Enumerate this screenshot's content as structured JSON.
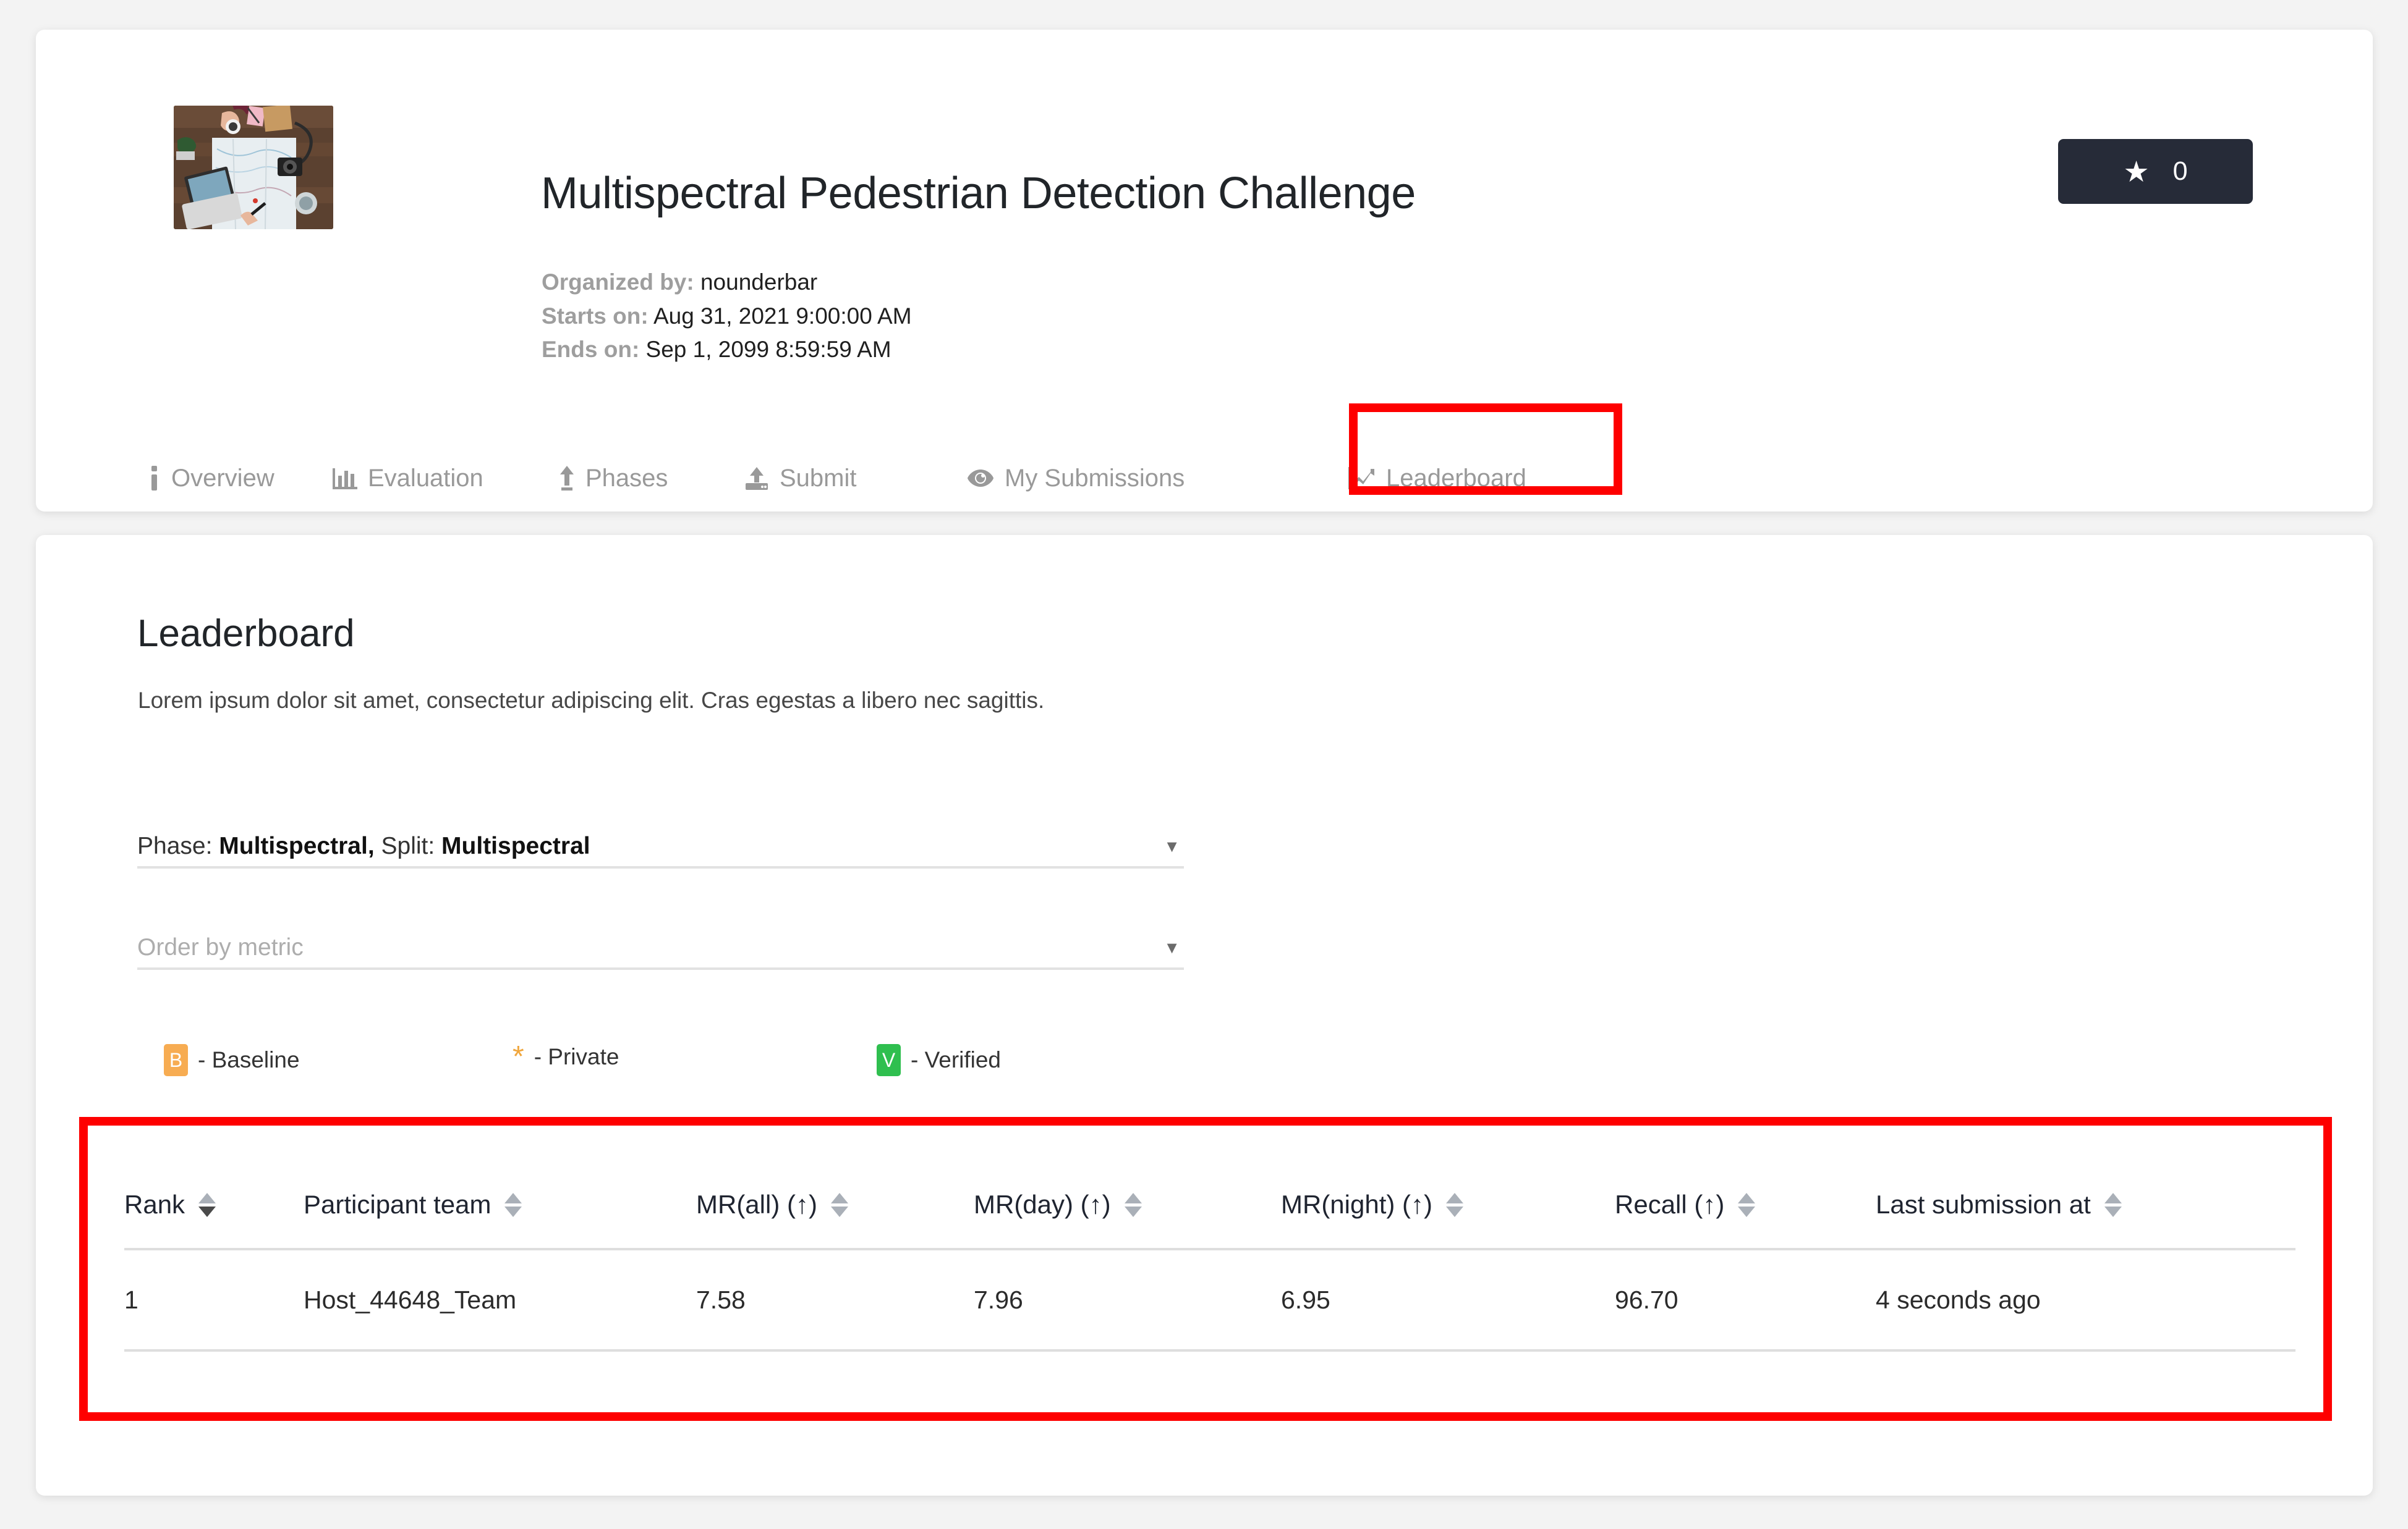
{
  "header": {
    "title": "Multispectral Pedestrian Detection Challenge",
    "organized_label": "Organized by:",
    "organized_value": "nounderbar",
    "starts_label": "Starts on:",
    "starts_value": "Aug 31, 2021 9:00:00 AM",
    "ends_label": "Ends on:",
    "ends_value": "Sep 1, 2099 8:59:59 AM",
    "star_glyph": "★",
    "star_count": "0",
    "thumbnail_alt": "desk-with-map-photo"
  },
  "nav": {
    "items": [
      {
        "label": "Overview",
        "icon": "info-icon"
      },
      {
        "label": "Evaluation",
        "icon": "bar-chart-icon"
      },
      {
        "label": "Phases",
        "icon": "upload-arrow-icon"
      },
      {
        "label": "Submit",
        "icon": "upload-icon"
      },
      {
        "label": "My Submissions",
        "icon": "eye-icon"
      },
      {
        "label": "Leaderboard",
        "icon": "line-chart-icon"
      }
    ]
  },
  "leaderboard": {
    "title": "Leaderboard",
    "description": "Lorem ipsum dolor sit amet, consectetur adipiscing elit. Cras egestas a libero nec sagittis.",
    "phase_select": {
      "phase_label": "Phase:",
      "phase_value": "Multispectral,",
      "split_label": "Split:",
      "split_value": "Multispectral",
      "caret": "▼"
    },
    "order_select": {
      "placeholder": "Order by metric",
      "caret": "▼"
    },
    "legend": [
      {
        "badge": "B",
        "text": "- Baseline",
        "color": "#f7ac52"
      },
      {
        "badge": "*",
        "text": "- Private",
        "color": "#f0a63c"
      },
      {
        "badge": "V",
        "text": "- Verified",
        "color": "#2fbf4f"
      }
    ],
    "table": {
      "columns": [
        "Rank",
        "Participant team",
        "MR(all) (↑)",
        "MR(day) (↑)",
        "MR(night) (↑)",
        "Recall (↑)",
        "Last submission at"
      ],
      "rows": [
        {
          "rank": "1",
          "team": "Host_44648_Team",
          "mr_all": "7.58",
          "mr_day": "7.96",
          "mr_night": "6.95",
          "recall": "96.70",
          "last_submission": "4 seconds ago"
        }
      ]
    }
  },
  "annotations": {
    "color": "#fe0000",
    "boxes": [
      "leaderboard-tab",
      "leaderboard-table"
    ]
  }
}
